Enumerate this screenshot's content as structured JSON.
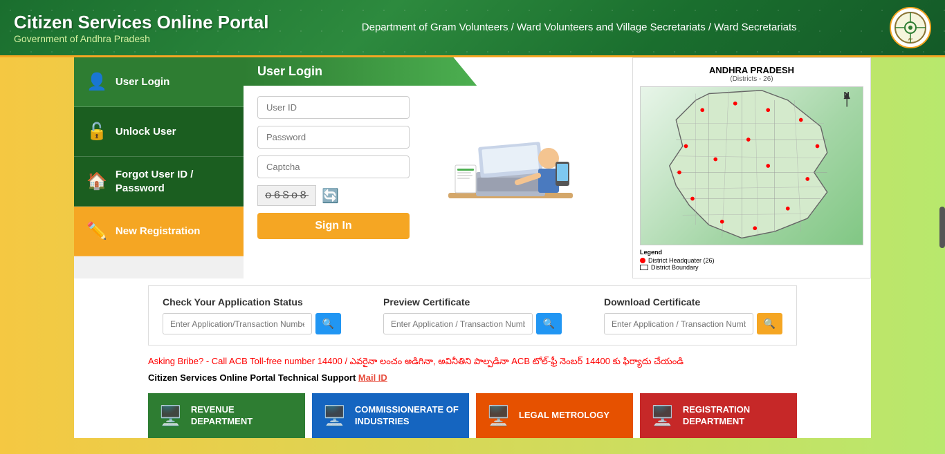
{
  "header": {
    "title": "Citizen Services Online Portal",
    "subtitle": "Government of Andhra Pradesh",
    "dept_name": "Department of Gram Volunteers / Ward Volunteers and Village Secretariats / Ward Secretariats"
  },
  "sidebar": {
    "items": [
      {
        "id": "user-login",
        "label": "User Login",
        "icon": "👤",
        "style": "active-green"
      },
      {
        "id": "unlock-user",
        "label": "Unlock User",
        "icon": "🔓",
        "style": "dark-green"
      },
      {
        "id": "forgot-password",
        "label": "Forgot User ID / Password",
        "icon": "🏠",
        "style": "dark-green"
      },
      {
        "id": "new-registration",
        "label": "New Registration",
        "icon": "✏️",
        "style": "orange"
      }
    ]
  },
  "login_form": {
    "title": "User Login",
    "user_id_placeholder": "User ID",
    "password_placeholder": "Password",
    "captcha_placeholder": "Captcha",
    "captcha_text": "o6So8",
    "signin_label": "Sign In"
  },
  "map": {
    "title": "ANDHRA PRADESH",
    "subtitle": "(Districts - 26)",
    "legend_hq": "District Headquater (26)",
    "legend_boundary": "District Boundary",
    "north_label": "N"
  },
  "status_section": {
    "check_title": "Check Your Application Status",
    "check_placeholder": "Enter Application/Transaction Number",
    "preview_title": "Preview Certificate",
    "preview_placeholder": "Enter Application / Transaction Number",
    "download_title": "Download Certificate",
    "download_placeholder": "Enter Application / Transaction Number"
  },
  "alert": {
    "bribe_text": "Asking Bribe? - Call ACB Toll-free number 14400 / ఎవరైనా లంచం అడిగినా, అవినీతిని పాల్పడినా ACB టోల్-ఫ్రీ నెంబర్ 14400 కు ఫిర్యాదు చేయండి",
    "support_label": "Citizen Services Online Portal Technical Support",
    "mail_label": "Mail ID"
  },
  "departments": [
    {
      "id": "revenue",
      "label": "REVENUE DEPARTMENT",
      "icon": "🖱️",
      "style": "green-tile"
    },
    {
      "id": "commissionerate",
      "label": "COMMISSIONERATE OF INDUSTRIES",
      "icon": "🖱️",
      "style": "blue-tile"
    },
    {
      "id": "legal",
      "label": "LEGAL METROLOGY",
      "icon": "🖱️",
      "style": "orange-tile"
    },
    {
      "id": "registration",
      "label": "REGISTRATION DEPARTMENT",
      "icon": "🖱️",
      "style": "red-tile"
    }
  ]
}
